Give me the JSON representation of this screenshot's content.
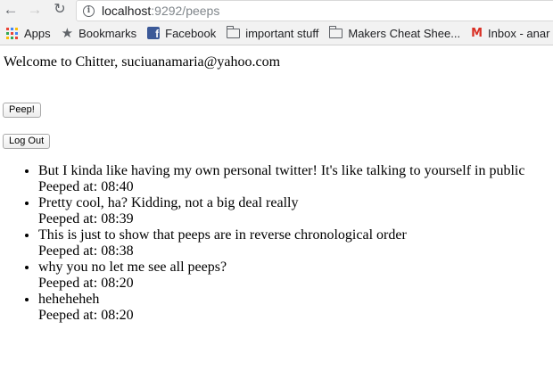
{
  "browser": {
    "url_host": "localhost",
    "url_path": ":9292/peeps",
    "bookmarks": [
      {
        "label": "Apps",
        "icon": "apps-icon"
      },
      {
        "label": "Bookmarks",
        "icon": "star-icon"
      },
      {
        "label": "Facebook",
        "icon": "facebook-icon"
      },
      {
        "label": "important stuff",
        "icon": "folder-icon"
      },
      {
        "label": "Makers Cheat Shee...",
        "icon": "folder-icon"
      },
      {
        "label": "Inbox - anar",
        "icon": "gmail-icon"
      }
    ]
  },
  "page": {
    "welcome": "Welcome to Chitter, suciuanamaria@yahoo.com",
    "peep_button": "Peep!",
    "logout_button": "Log Out",
    "peeps": [
      {
        "text": "But I kinda like having my own personal twitter! It's like talking to yourself in public",
        "time": "Peeped at: 08:40"
      },
      {
        "text": "Pretty cool, ha? Kidding, not a big deal really",
        "time": "Peeped at: 08:39"
      },
      {
        "text": "This is just to show that peeps are in reverse chronological order",
        "time": "Peeped at: 08:38"
      },
      {
        "text": "why you no let me see all peeps?",
        "time": "Peeped at: 08:20"
      },
      {
        "text": "heheheheh",
        "time": "Peeped at: 08:20"
      }
    ]
  }
}
